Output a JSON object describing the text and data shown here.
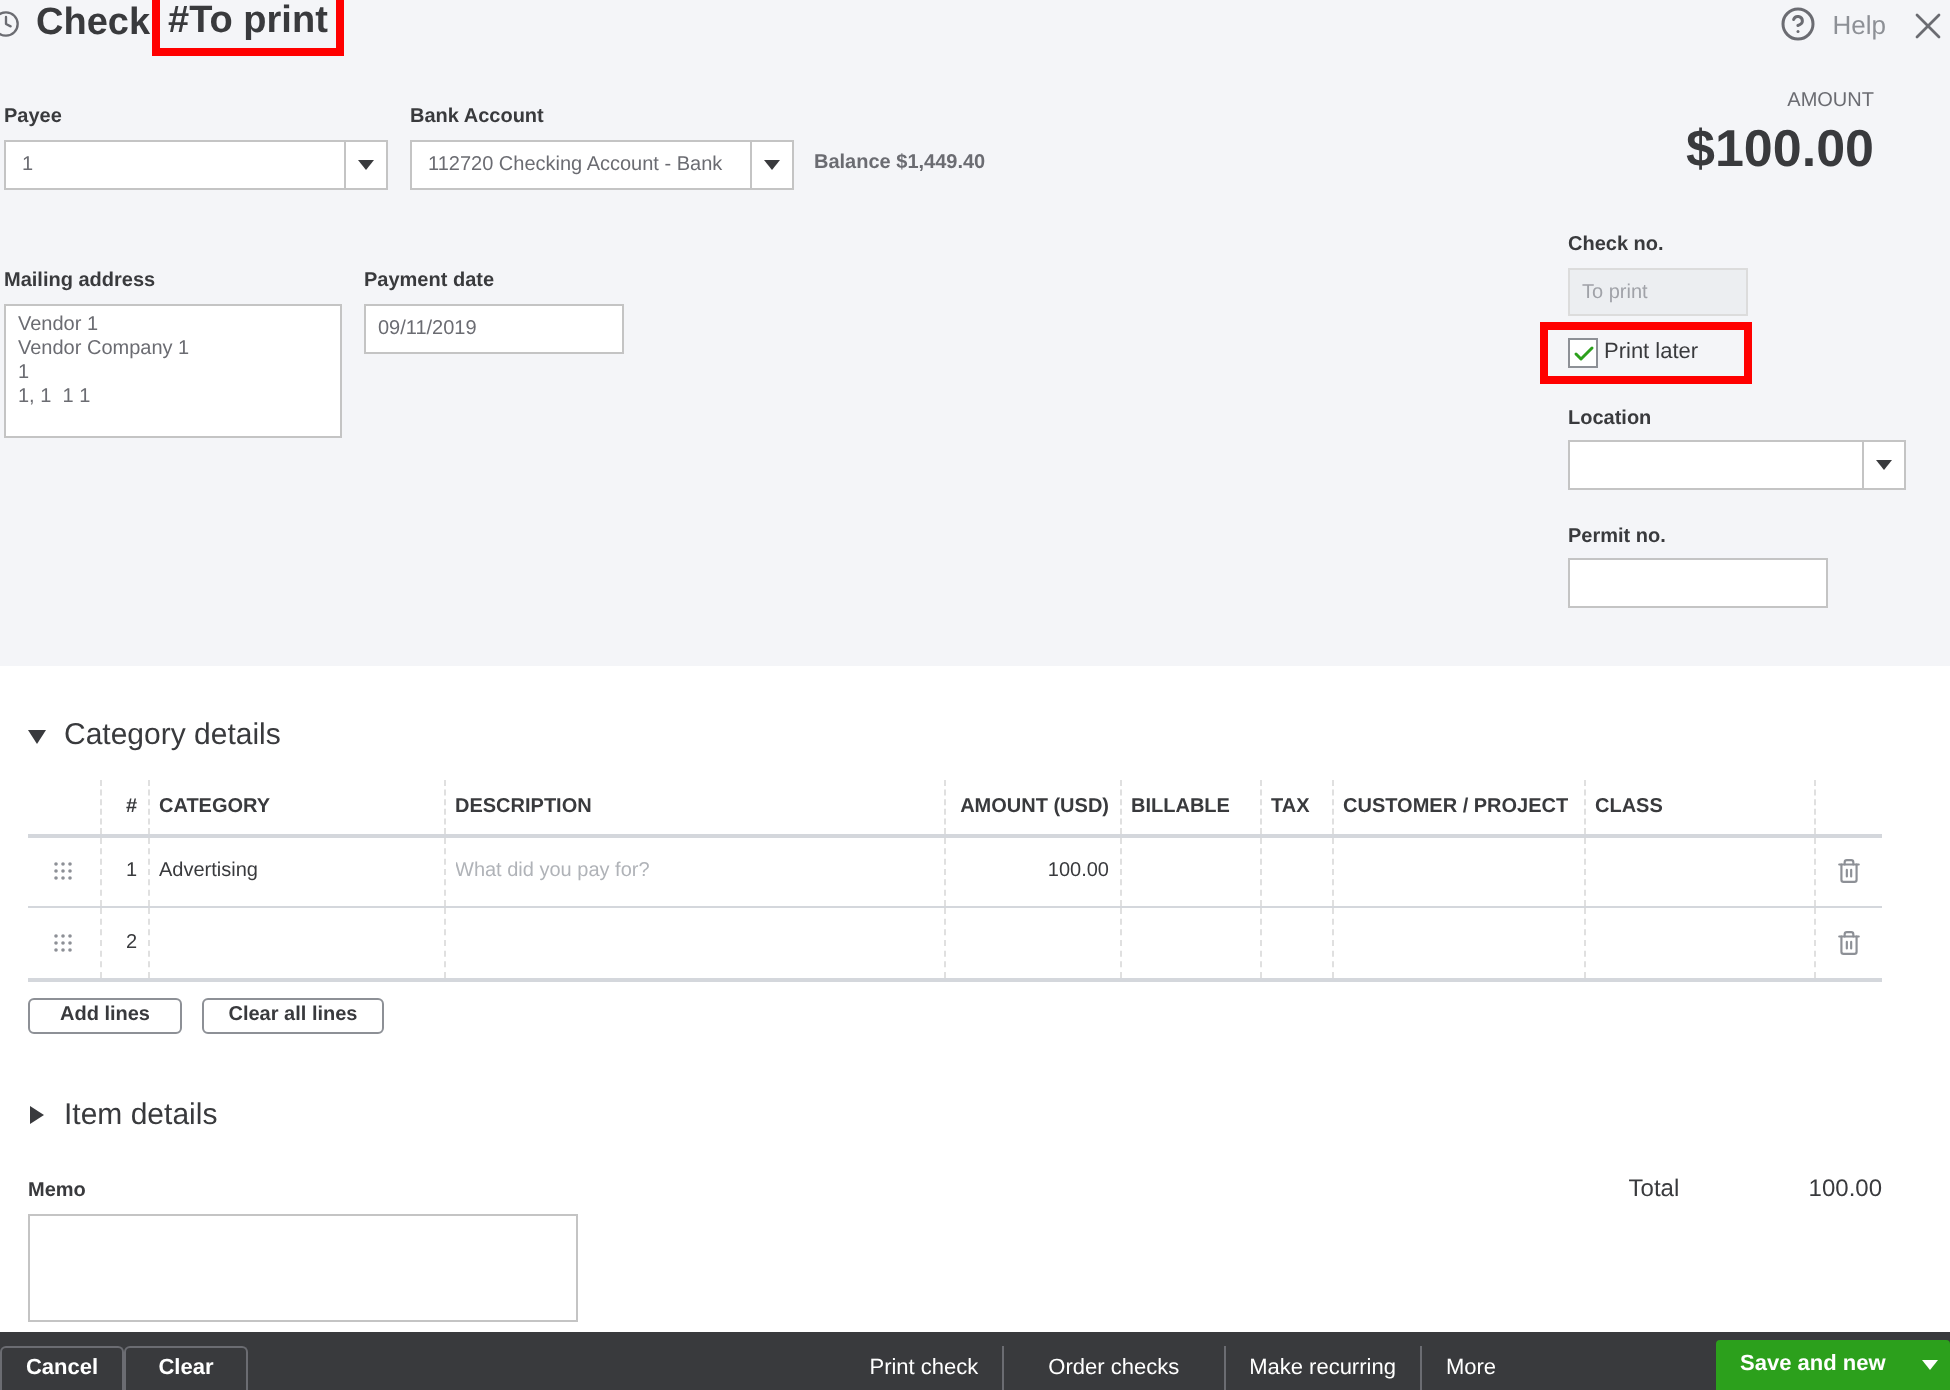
{
  "header": {
    "title": "Check",
    "number": "#To print",
    "help": "Help"
  },
  "payee": {
    "label": "Payee",
    "value": "1"
  },
  "bank_account": {
    "label": "Bank Account",
    "value": "112720 Checking Account - Bank",
    "balance": "Balance $1,449.40"
  },
  "amount": {
    "label": "AMOUNT",
    "value": "$100.00"
  },
  "mailing_address": {
    "label": "Mailing address",
    "lines": [
      "Vendor 1",
      "Vendor Company 1",
      "1",
      "1, 1  1 1"
    ]
  },
  "payment_date": {
    "label": "Payment date",
    "value": "09/11/2019"
  },
  "check_no": {
    "label": "Check no.",
    "placeholder": "To print"
  },
  "print_later": {
    "label": "Print later",
    "checked": true
  },
  "location": {
    "label": "Location"
  },
  "permit_no": {
    "label": "Permit no."
  },
  "category_details": {
    "title": "Category details",
    "expanded": true,
    "columns": [
      "#",
      "CATEGORY",
      "DESCRIPTION",
      "AMOUNT (USD)",
      "BILLABLE",
      "TAX",
      "CUSTOMER / PROJECT",
      "CLASS"
    ],
    "rows": [
      {
        "number": "1",
        "category": "Advertising",
        "description_placeholder": "What did you pay for?",
        "amount": "100.00"
      },
      {
        "number": "2",
        "category": "",
        "description_placeholder": "",
        "amount": ""
      }
    ],
    "buttons": [
      "Add lines",
      "Clear all lines"
    ]
  },
  "item_details": {
    "title": "Item details",
    "expanded": false
  },
  "memo": {
    "label": "Memo"
  },
  "total": {
    "label": "Total",
    "value": "100.00"
  },
  "footer": {
    "left_buttons": [
      "Cancel",
      "Clear"
    ],
    "center_buttons": [
      "Print check",
      "Order checks",
      "Make recurring",
      "More"
    ],
    "primary": "Save and new"
  }
}
